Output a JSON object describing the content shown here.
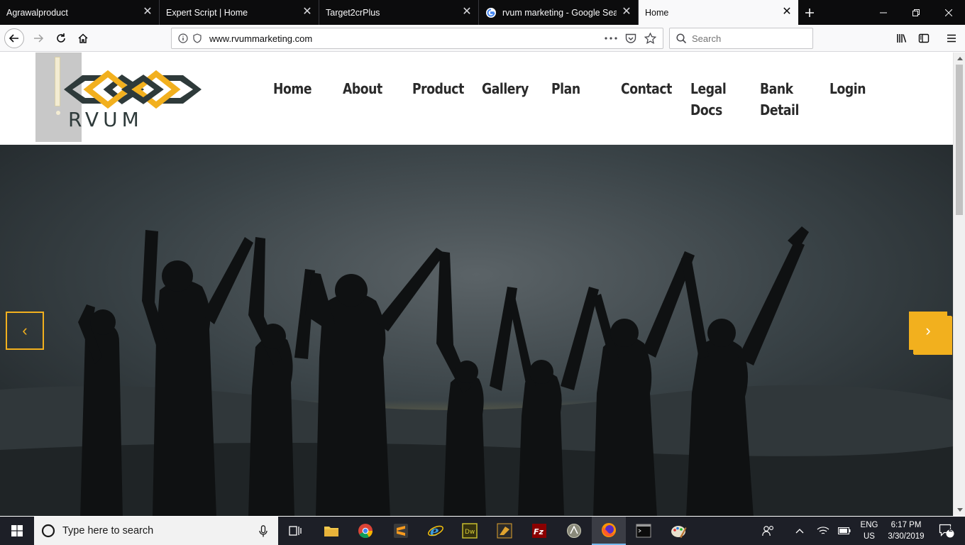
{
  "browser": {
    "tabs": [
      {
        "title": "Agrawalproduct",
        "active": false
      },
      {
        "title": "Expert Script | Home",
        "active": false
      },
      {
        "title": "Target2crPlus",
        "active": false
      },
      {
        "title": "rvum marketing - Google Sear",
        "active": false,
        "favicon": "google-icon"
      },
      {
        "title": "Home",
        "active": true
      }
    ],
    "url": "www.rvummarketing.com",
    "search_placeholder": "Search"
  },
  "site": {
    "logo_text": "RVUM",
    "menu": [
      {
        "label": "Home"
      },
      {
        "label": "About"
      },
      {
        "label": "Product"
      },
      {
        "label": "Gallery"
      },
      {
        "label": "Plan"
      },
      {
        "label": "Contact"
      },
      {
        "label": "Legal Docs"
      },
      {
        "label": "Bank Detail"
      },
      {
        "label": "Login"
      }
    ],
    "hero": {
      "prev_arrow": "‹",
      "next_arrow": "›"
    },
    "colors": {
      "accent": "#f2b01e",
      "logo_dark": "#2e3a3a",
      "hero_bg": "#2b3337"
    }
  },
  "taskbar": {
    "search_placeholder": "Type here to search",
    "language": "ENG",
    "region": "US",
    "time": "6:17 PM",
    "date": "3/30/2019",
    "notifications": "2"
  }
}
